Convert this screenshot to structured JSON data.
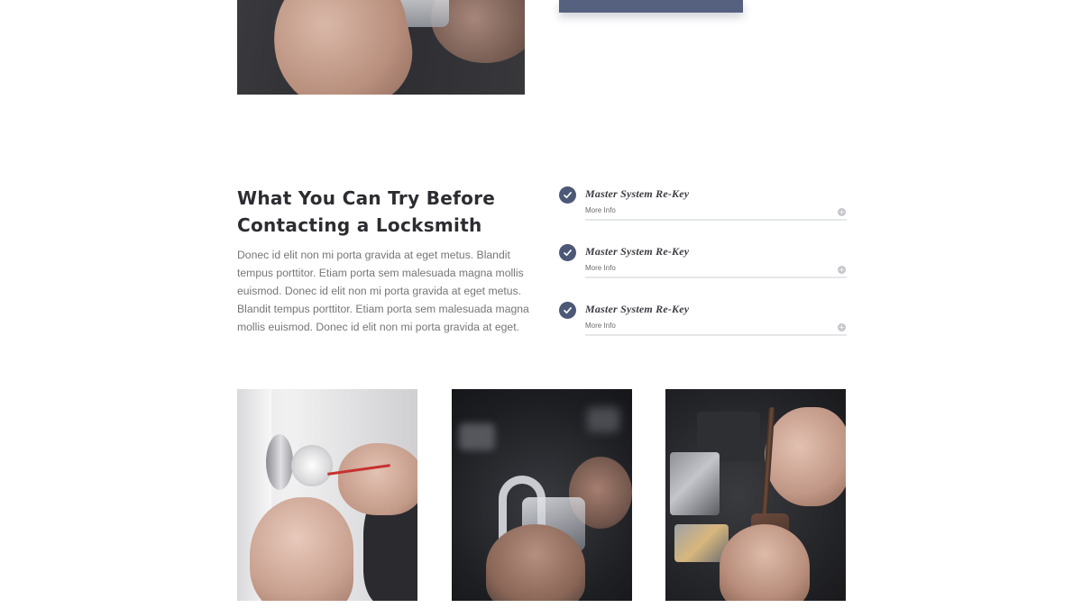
{
  "section": {
    "heading_line1": "What You Can Try Before",
    "heading_line2": "Contacting a Locksmith",
    "body": "Donec id elit non mi porta gravida at eget metus. Blandit tempus porttitor. Etiam porta sem malesuada magna mollis euismod. Donec id elit non mi porta gravida at eget metus. Blandit tempus porttitor. Etiam porta sem malesuada magna mollis euismod. Donec id elit non mi porta gravida at eget."
  },
  "checklist": [
    {
      "title": "Master System Re-Key",
      "link": "More Info",
      "icon": "check-icon",
      "expand_icon": "plus-icon"
    },
    {
      "title": "Master System Re-Key",
      "link": "More Info",
      "icon": "check-icon",
      "expand_icon": "plus-icon"
    },
    {
      "title": "Master System Re-Key",
      "link": "More Info",
      "icon": "check-icon",
      "expand_icon": "plus-icon"
    }
  ],
  "gallery": [
    {
      "subject": "hands picking a door knob lock"
    },
    {
      "subject": "hands holding a clear practice padlock"
    },
    {
      "subject": "hands servicing a lock cylinder with a screwdriver"
    }
  ],
  "colors": {
    "accent": "#4d5877",
    "cta_bar": "#56617f",
    "heading": "#2c2c31",
    "body_text": "#76767a",
    "divider": "#e6e7ea"
  }
}
